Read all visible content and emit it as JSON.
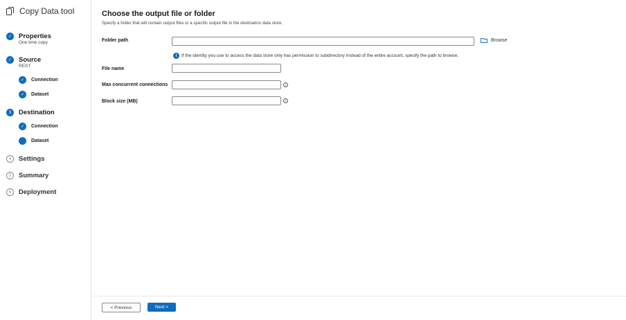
{
  "app": {
    "title": "Copy Data tool"
  },
  "steps": [
    {
      "num": "✓",
      "label": "Properties",
      "sub": "One time copy"
    },
    {
      "num": "✓",
      "label": "Source",
      "sub": "REST"
    },
    {
      "num": "3",
      "label": "Destination",
      "sub": ""
    },
    {
      "num": "4",
      "label": "Settings",
      "sub": ""
    },
    {
      "num": "5",
      "label": "Summary",
      "sub": ""
    },
    {
      "num": "6",
      "label": "Deployment",
      "sub": ""
    }
  ],
  "source_substeps": [
    {
      "mark": "✓",
      "label": "Connection"
    },
    {
      "mark": "✓",
      "label": "Dataset"
    }
  ],
  "destination_substeps": [
    {
      "mark": "✓",
      "label": "Connection"
    },
    {
      "mark": "",
      "label": "Dataset"
    }
  ],
  "page": {
    "title": "Choose the output file or folder",
    "description": "Specify a folder that will contain output files or a specific output file in the destination data store."
  },
  "form": {
    "folder_path": {
      "label": "Folder path",
      "value": ""
    },
    "browse_label": "Browse",
    "info_note": "If the identity you use to access the data store only has permission to subdirectory instead of the entire account, specify the path to browse.",
    "info_icon": "i",
    "file_name": {
      "label": "File name",
      "value": ""
    },
    "max_concurrent": {
      "label": "Max concurrent connections",
      "value": ""
    },
    "block_size": {
      "label": "Block size (MB)",
      "value": ""
    },
    "tooltip_glyph": "i"
  },
  "footer": {
    "previous_label": "< Previous",
    "next_label": "Next >"
  },
  "colors": {
    "accent": "#0f6cbd",
    "border": "#8a8886"
  },
  "icons": {
    "app": "copy-icon",
    "browse": "folder-icon",
    "info": "info-icon",
    "tooltip": "info-circle-icon"
  }
}
